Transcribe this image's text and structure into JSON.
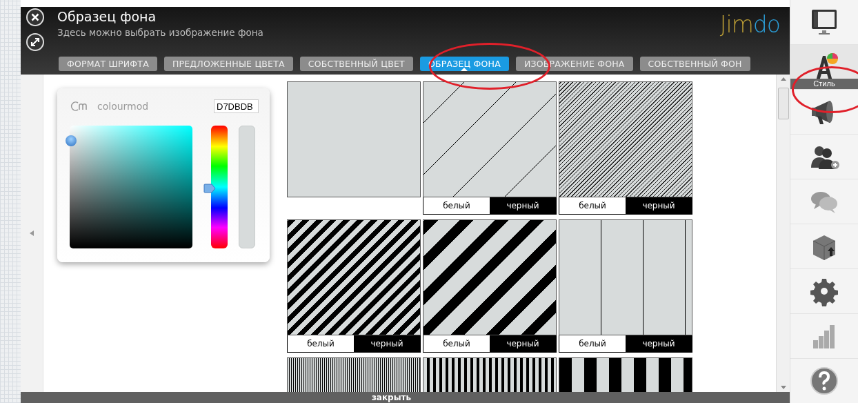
{
  "header": {
    "title": "Образец фона",
    "subtitle": "Здесь можно выбрать изображение фона",
    "logo_parts": [
      {
        "text": "Jim",
        "color": "#b79a35"
      },
      {
        "text": "do",
        "color": "#2b9fd9"
      }
    ]
  },
  "tabs": [
    {
      "label": "ФОРМАТ ШРИФТА",
      "selected": false
    },
    {
      "label": "ПРЕДЛОЖЕННЫЕ ЦВЕТА",
      "selected": false
    },
    {
      "label": "СОБСТВЕННЫЙ ЦВЕТ",
      "selected": false
    },
    {
      "label": "ОБРАЗЕЦ ФОНА",
      "selected": true
    },
    {
      "label": "ИЗОБРАЖЕНИЕ ФОНА",
      "selected": false
    },
    {
      "label": "СОБСТВЕННЫЙ ФОН",
      "selected": false
    }
  ],
  "color_picker": {
    "brand": "colourmod",
    "hex_value": "D7DBDB",
    "hue": {
      "level": 0.51
    }
  },
  "patterns": [
    {
      "kind": "plain"
    },
    {
      "kind": "sparse-diagonal",
      "options": [
        "белый",
        "черный"
      ]
    },
    {
      "kind": "fine-diagonal",
      "options": [
        "белый",
        "черный"
      ]
    },
    {
      "kind": "medium-diagonal",
      "options": [
        "белый",
        "черный"
      ]
    },
    {
      "kind": "wide-diagonal",
      "options": [
        "белый",
        "черный"
      ]
    },
    {
      "kind": "vertical-lines",
      "options": [
        "белый",
        "черный"
      ]
    },
    {
      "kind": "fine-vertical"
    },
    {
      "kind": "medium-vertical"
    },
    {
      "kind": "wide-vertical"
    }
  ],
  "sidebar": {
    "items": [
      {
        "kind": "monitor",
        "selected": false
      },
      {
        "kind": "style",
        "label": "Стиль",
        "selected": true
      },
      {
        "kind": "megaphone",
        "selected": false
      },
      {
        "kind": "users",
        "selected": false
      },
      {
        "kind": "chat",
        "selected": false
      },
      {
        "kind": "box",
        "selected": false
      },
      {
        "kind": "gear",
        "selected": false
      },
      {
        "kind": "stats",
        "selected": false
      },
      {
        "kind": "help",
        "selected": false
      }
    ]
  },
  "footer": {
    "close_label": "закрыть"
  }
}
